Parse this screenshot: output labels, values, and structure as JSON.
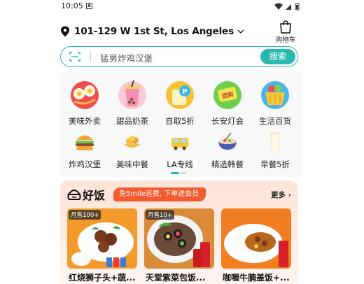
{
  "status_bar": {
    "time": "10:05",
    "notification_glyph": "A"
  },
  "header": {
    "address": "101-129 W 1st St, Los Angeles",
    "cart_label": "购物车"
  },
  "search": {
    "placeholder": "猛男炸鸡汉堡",
    "button_label": "搜索"
  },
  "categories": [
    {
      "label": "美味外卖",
      "icon": "takeout-icon"
    },
    {
      "label": "甜品奶茶",
      "icon": "milk-tea-icon"
    },
    {
      "label": "自取5折",
      "icon": "pickup-icon"
    },
    {
      "label": "长安灯会",
      "icon": "lantern-festival-icon"
    },
    {
      "label": "生活百货",
      "icon": "grocery-basket-icon"
    },
    {
      "label": "炸鸡汉堡",
      "icon": "burger-icon"
    },
    {
      "label": "美味中餐",
      "icon": "chinese-food-icon"
    },
    {
      "label": "LA专线",
      "icon": "bus-icon"
    },
    {
      "label": "精选韩餐",
      "icon": "korean-food-icon"
    },
    {
      "label": "早餐5折",
      "icon": "milk-glass-icon"
    }
  ],
  "good_food": {
    "brand": "好饭",
    "promo": "免5mile运费, 下单送会员",
    "more": "更多",
    "items": [
      {
        "badge": "月售100+",
        "title": "红烧狮子头+蔬..."
      },
      {
        "badge": "月售10+",
        "title": "天堂紫菜包饭..."
      },
      {
        "badge": "",
        "title": "咖喱牛腩盖饭+..."
      }
    ]
  },
  "colors": {
    "accent": "#2ab7ae",
    "promo": "#f35a2d"
  }
}
